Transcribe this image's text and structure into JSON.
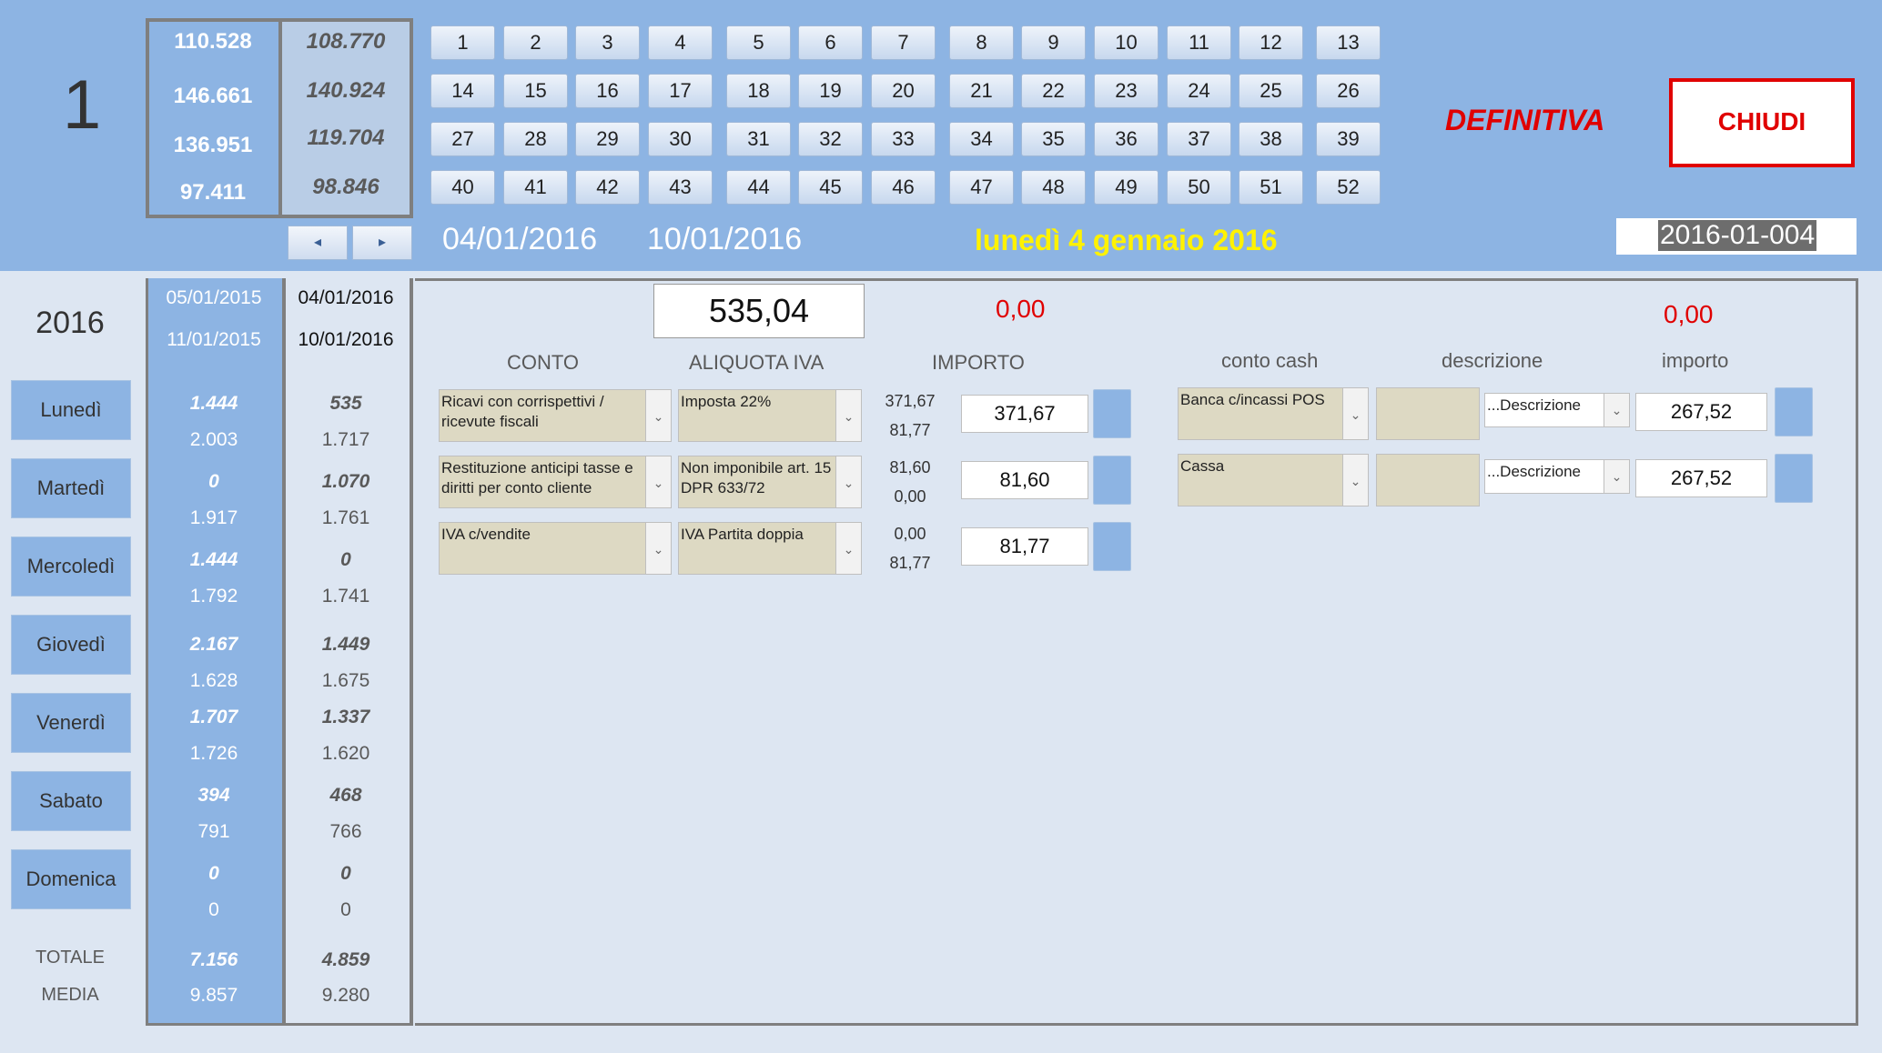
{
  "header": {
    "week": "1",
    "summary": {
      "col1": [
        "110.528",
        "146.661",
        "136.951",
        "97.411"
      ],
      "col2": [
        "108.770",
        "140.924",
        "119.704",
        "98.846"
      ]
    },
    "weeks": [
      "1",
      "2",
      "3",
      "4",
      "5",
      "6",
      "7",
      "8",
      "9",
      "10",
      "11",
      "12",
      "13",
      "14",
      "15",
      "16",
      "17",
      "18",
      "19",
      "20",
      "21",
      "22",
      "23",
      "24",
      "25",
      "26",
      "27",
      "28",
      "29",
      "30",
      "31",
      "32",
      "33",
      "34",
      "35",
      "36",
      "37",
      "38",
      "39",
      "40",
      "41",
      "42",
      "43",
      "44",
      "45",
      "46",
      "47",
      "48",
      "49",
      "50",
      "51",
      "52"
    ],
    "prev_icon": "◂",
    "next_icon": "▸",
    "date_from": "04/01/2016",
    "date_to": "10/01/2016",
    "day_label": "lunedì 4 gennaio 2016",
    "status": "DEFINITIVA",
    "close_label": "CHIUDI",
    "code": "2016-01-004"
  },
  "left": {
    "year": "2016",
    "days": [
      "Lunedì",
      "Martedì",
      "Mercoledì",
      "Giovedì",
      "Venerdì",
      "Sabato",
      "Domenica"
    ],
    "totale_label": "TOTALE",
    "media_label": "MEDIA"
  },
  "stats": {
    "col1": {
      "from": "05/01/2015",
      "to": "11/01/2015",
      "days": [
        [
          "1.444",
          "2.003"
        ],
        [
          "0",
          "1.917"
        ],
        [
          "1.444",
          "1.792"
        ],
        [
          "2.167",
          "1.628"
        ],
        [
          "1.707",
          "1.726"
        ],
        [
          "394",
          "791"
        ],
        [
          "0",
          "0"
        ]
      ],
      "totale": "7.156",
      "media": "9.857"
    },
    "col2": {
      "from": "04/01/2016",
      "to": "10/01/2016",
      "days": [
        [
          "535",
          "1.717"
        ],
        [
          "1.070",
          "1.761"
        ],
        [
          "0",
          "1.741"
        ],
        [
          "1.449",
          "1.675"
        ],
        [
          "1.337",
          "1.620"
        ],
        [
          "468",
          "766"
        ],
        [
          "0",
          "0"
        ]
      ],
      "totale": "4.859",
      "media": "9.280"
    }
  },
  "panel": {
    "total": "535,04",
    "diff_left": "0,00",
    "diff_right": "0,00",
    "headers": {
      "conto": "CONTO",
      "aliquota": "ALIQUOTA IVA",
      "importo": "IMPORTO",
      "conto_cash": "conto cash",
      "descrizione": "descrizione",
      "importo2": "importo"
    },
    "rows": [
      {
        "conto": "Ricavi con corrispettivi / ricevute fiscali",
        "aliquota": "Imposta 22%",
        "a": "371,67",
        "b": "81,77",
        "importo": "371,67"
      },
      {
        "conto": "Restituzione anticipi tasse e diritti per conto cliente",
        "aliquota": "Non imponibile art. 15 DPR 633/72",
        "a": "81,60",
        "b": "0,00",
        "importo": "81,60"
      },
      {
        "conto": "IVA c/vendite",
        "aliquota": "IVA Partita doppia",
        "a": "0,00",
        "b": "81,77",
        "importo": "81,77"
      }
    ],
    "cash": [
      {
        "conto": "Banca c/incassi POS",
        "desc": "...Descrizione",
        "importo": "267,52"
      },
      {
        "conto": "Cassa",
        "desc": "...Descrizione",
        "importo": "267,52"
      }
    ],
    "dropdown_icon": "⌄"
  },
  "colors": {
    "accent": "#8db4e3",
    "red": "#e00000",
    "yellow": "#fff200",
    "background": "#dde6f2"
  }
}
